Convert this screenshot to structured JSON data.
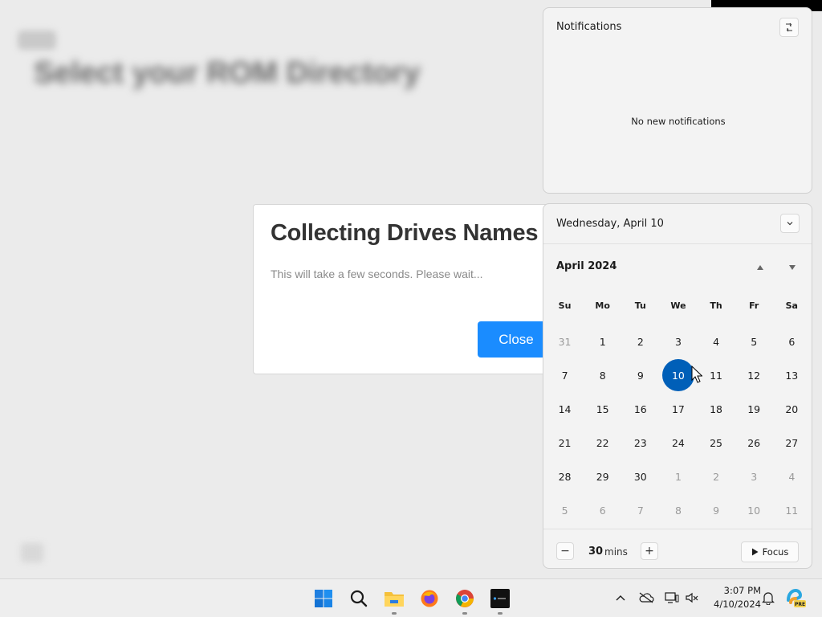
{
  "background": {
    "title": "Select your ROM Directory"
  },
  "dialog": {
    "title": "Collecting Drives Names",
    "message": "This will take a few seconds. Please wait...",
    "close_label": "Close"
  },
  "notifications": {
    "title": "Notifications",
    "empty_message": "No new notifications",
    "settings_icon": "notification-settings-icon"
  },
  "calendar": {
    "date_label": "Wednesday, April 10",
    "month_label": "April 2024",
    "weekdays": [
      "Su",
      "Mo",
      "Tu",
      "We",
      "Th",
      "Fr",
      "Sa"
    ],
    "days": [
      {
        "d": "31",
        "other": true
      },
      {
        "d": "1"
      },
      {
        "d": "2"
      },
      {
        "d": "3"
      },
      {
        "d": "4"
      },
      {
        "d": "5"
      },
      {
        "d": "6"
      },
      {
        "d": "7"
      },
      {
        "d": "8"
      },
      {
        "d": "9"
      },
      {
        "d": "10",
        "today": true
      },
      {
        "d": "11"
      },
      {
        "d": "12"
      },
      {
        "d": "13"
      },
      {
        "d": "14"
      },
      {
        "d": "15"
      },
      {
        "d": "16"
      },
      {
        "d": "17"
      },
      {
        "d": "18"
      },
      {
        "d": "19"
      },
      {
        "d": "20"
      },
      {
        "d": "21"
      },
      {
        "d": "22"
      },
      {
        "d": "23"
      },
      {
        "d": "24"
      },
      {
        "d": "25"
      },
      {
        "d": "26"
      },
      {
        "d": "27"
      },
      {
        "d": "28"
      },
      {
        "d": "29"
      },
      {
        "d": "30"
      },
      {
        "d": "1",
        "other": true
      },
      {
        "d": "2",
        "other": true
      },
      {
        "d": "3",
        "other": true
      },
      {
        "d": "4",
        "other": true
      },
      {
        "d": "5",
        "other": true
      },
      {
        "d": "6",
        "other": true
      },
      {
        "d": "7",
        "other": true
      },
      {
        "d": "8",
        "other": true
      },
      {
        "d": "9",
        "other": true
      },
      {
        "d": "10",
        "other": true
      },
      {
        "d": "11",
        "other": true
      }
    ],
    "today_color": "#005fb8"
  },
  "focus": {
    "value": "30",
    "unit": "mins",
    "minus_label": "−",
    "plus_label": "+",
    "button_label": "Focus"
  },
  "taskbar": {
    "time": "3:07 PM",
    "date": "4/10/2024",
    "apps": [
      "windows-start-icon",
      "search-icon",
      "file-explorer-icon",
      "firefox-icon",
      "chrome-icon",
      "terminal-app-icon"
    ],
    "tray": [
      "chevron-up-icon",
      "onedrive-offline-icon",
      "display-icon",
      "volume-muted-icon",
      "bell-icon",
      "copilot-pre-icon"
    ],
    "copilot_badge": "PRE"
  },
  "colors": {
    "accent": "#1a8cff",
    "calendar_today": "#005fb8"
  }
}
